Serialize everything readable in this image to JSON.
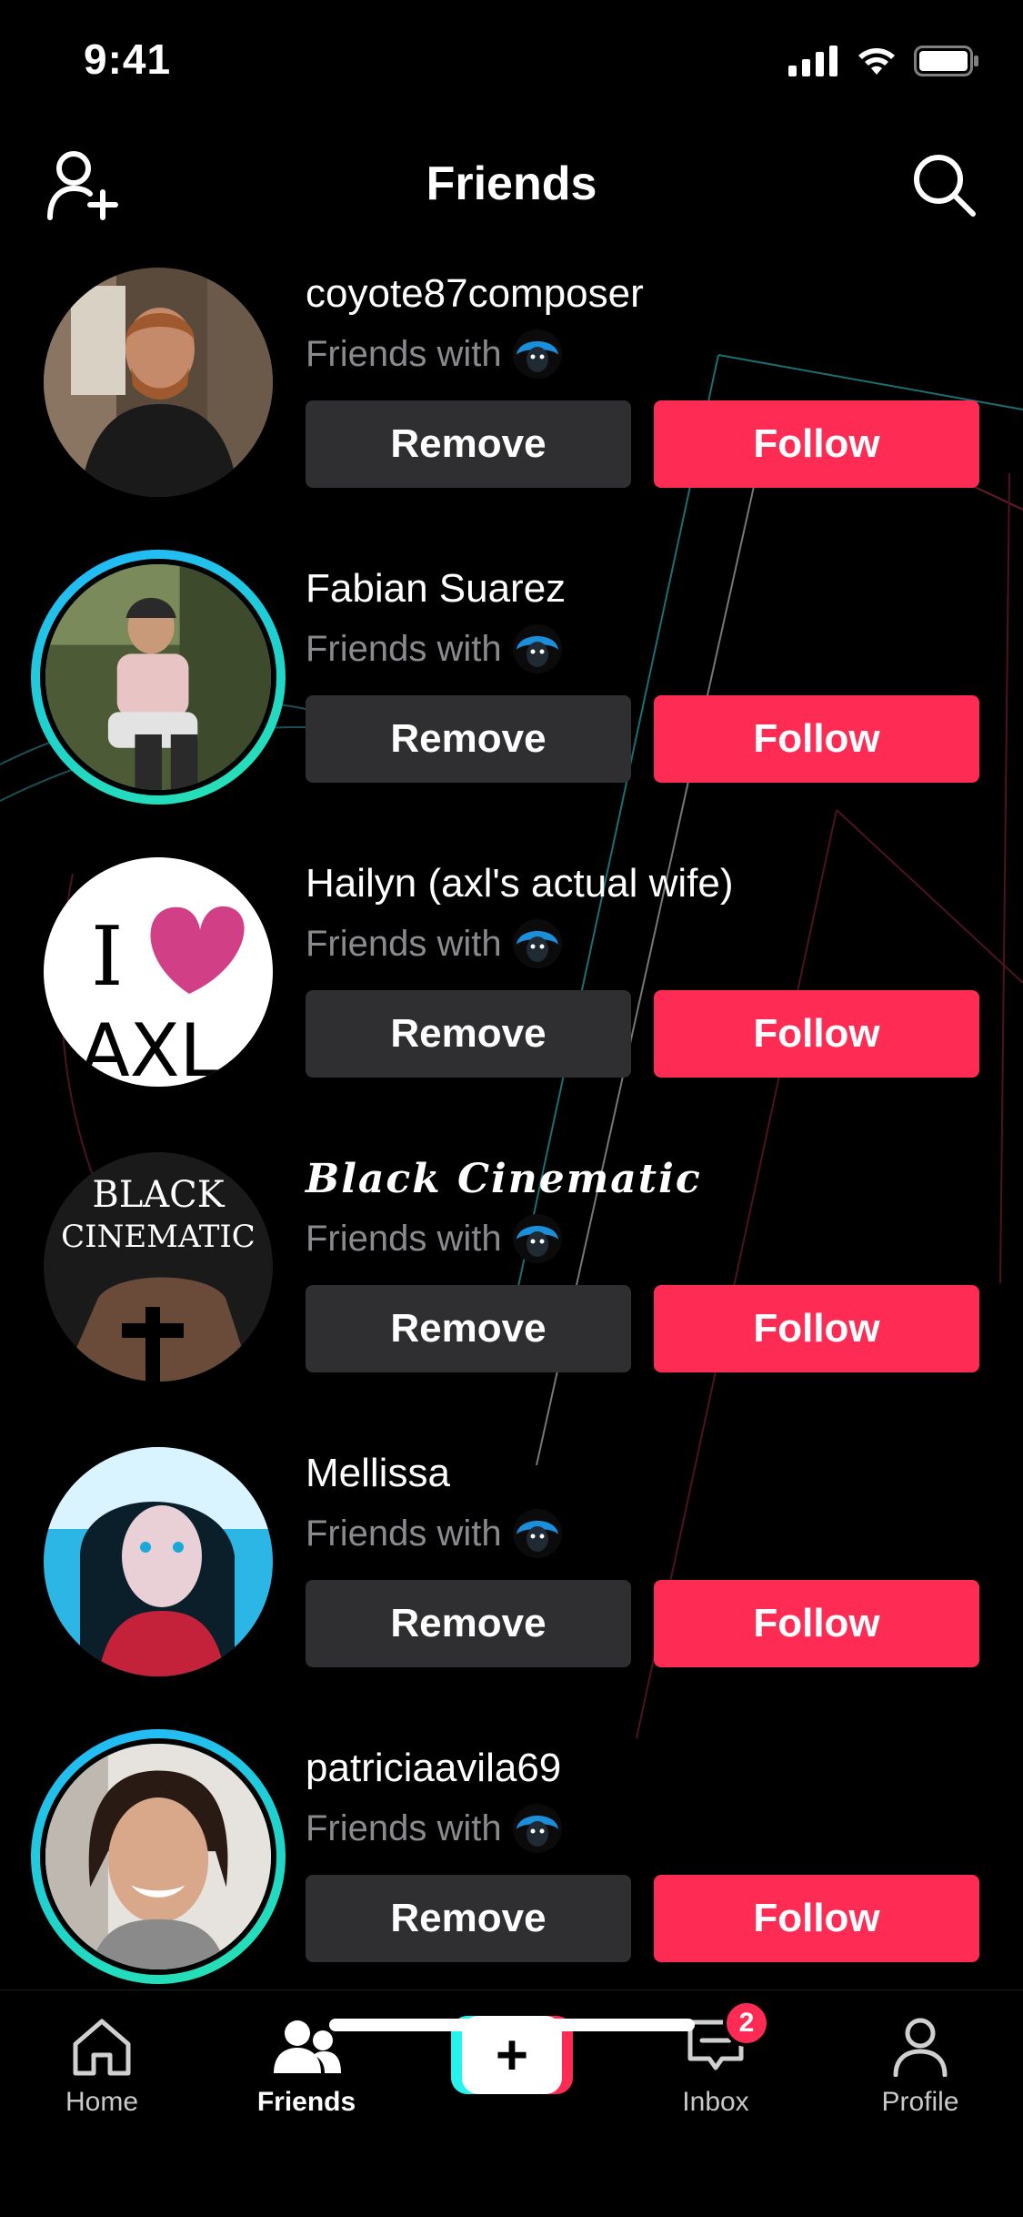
{
  "status_bar": {
    "time": "9:41",
    "icons": [
      "signal-icon",
      "wifi-icon",
      "battery-icon"
    ]
  },
  "header": {
    "title": "Friends",
    "left_icon": "add-friend-icon",
    "right_icon": "search-icon"
  },
  "friends": [
    {
      "username": "coyote87composer",
      "friends_with": "Friends with",
      "remove_label": "Remove",
      "follow_label": "Follow",
      "story_ring": false
    },
    {
      "username": "Fabian Suarez",
      "friends_with": "Friends with",
      "remove_label": "Remove",
      "follow_label": "Follow",
      "story_ring": true
    },
    {
      "username": "Hailyn (axl's actual wife)",
      "friends_with": "Friends with",
      "remove_label": "Remove",
      "follow_label": "Follow",
      "story_ring": false,
      "avatar_text_top": "I",
      "avatar_text_bottom": "AXL"
    },
    {
      "username": "Black Cinematic",
      "friends_with": "Friends with",
      "remove_label": "Remove",
      "follow_label": "Follow",
      "story_ring": false,
      "avatar_text_top": "BLACK",
      "avatar_text_bottom": "CINEMATIC"
    },
    {
      "username": "Mellissa",
      "friends_with": "Friends with",
      "remove_label": "Remove",
      "follow_label": "Follow",
      "story_ring": false
    },
    {
      "username": "patriciaavila69",
      "friends_with": "Friends with",
      "remove_label": "Remove",
      "follow_label": "Follow",
      "story_ring": true
    }
  ],
  "bottom_nav": {
    "items": [
      {
        "label": "Home",
        "icon": "home-icon",
        "active": false
      },
      {
        "label": "Friends",
        "icon": "friends-icon",
        "active": true
      },
      {
        "label": "",
        "icon": "create-plus-icon",
        "active": false
      },
      {
        "label": "Inbox",
        "icon": "inbox-icon",
        "active": false,
        "badge": "2"
      },
      {
        "label": "Profile",
        "icon": "profile-icon",
        "active": false
      }
    ]
  },
  "colors": {
    "background": "#000000",
    "follow": "#fe2c55",
    "remove": "#2f2f31",
    "secondary_text": "#8a8a8e",
    "story_ring": "#22b6ff",
    "accent_cyan": "#25f4ee"
  }
}
